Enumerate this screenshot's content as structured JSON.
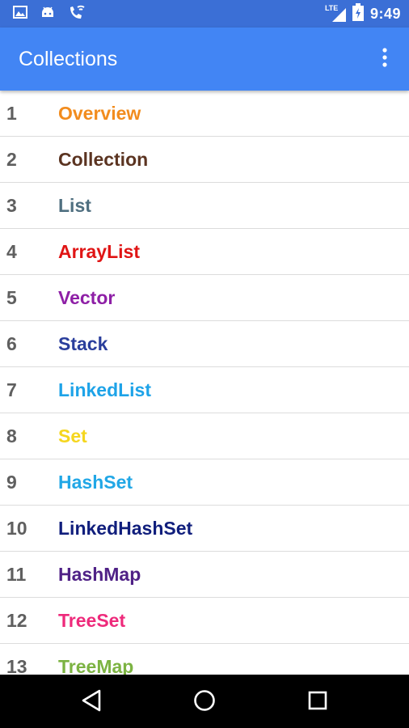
{
  "status_bar": {
    "time": "9:49",
    "network_label": "LTE",
    "left_icons": [
      "image-icon",
      "android-icon",
      "phone-wifi-icon"
    ],
    "right_icons": [
      "lte-signal-icon",
      "battery-icon"
    ]
  },
  "app_bar": {
    "title": "Collections",
    "overflow_icon": "more-vertical-icon"
  },
  "list": {
    "items": [
      {
        "number": "1",
        "label": "Overview",
        "color": "#f28c1e"
      },
      {
        "number": "2",
        "label": "Collection",
        "color": "#5b3421"
      },
      {
        "number": "3",
        "label": "List",
        "color": "#4f6f80"
      },
      {
        "number": "4",
        "label": "ArrayList",
        "color": "#e01515"
      },
      {
        "number": "5",
        "label": "Vector",
        "color": "#8e1fa6"
      },
      {
        "number": "6",
        "label": "Stack",
        "color": "#2a3e9c"
      },
      {
        "number": "7",
        "label": "LinkedList",
        "color": "#1ea3e8"
      },
      {
        "number": "8",
        "label": "Set",
        "color": "#f5d61e"
      },
      {
        "number": "9",
        "label": "HashSet",
        "color": "#21a7e6"
      },
      {
        "number": "10",
        "label": "LinkedHashSet",
        "color": "#101e7c"
      },
      {
        "number": "11",
        "label": "HashMap",
        "color": "#4f2186"
      },
      {
        "number": "12",
        "label": "TreeSet",
        "color": "#ee2a7b"
      },
      {
        "number": "13",
        "label": "TreeMap",
        "color": "#7cb342"
      }
    ]
  },
  "nav_bar": {
    "back_icon": "back-icon",
    "home_icon": "home-icon",
    "recents_icon": "recents-icon"
  }
}
